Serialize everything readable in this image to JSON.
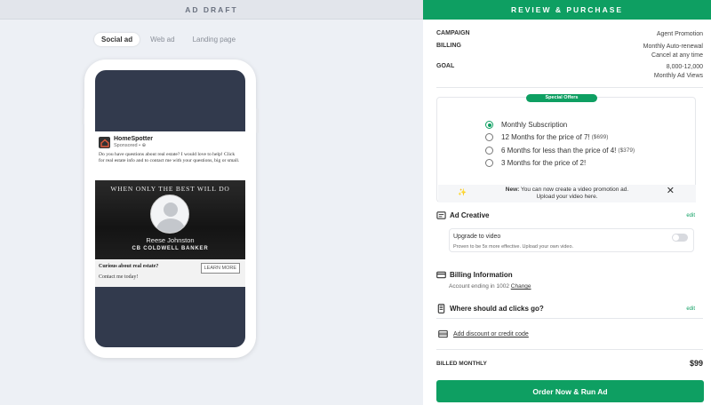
{
  "left": {
    "header": "AD DRAFT",
    "tabs": [
      {
        "label": "Social ad",
        "active": true
      },
      {
        "label": "Web ad",
        "active": false
      },
      {
        "label": "Landing page",
        "active": false
      }
    ],
    "post": {
      "brand_name": "HomeSpotter",
      "sponsored": "Sponsored • ⊕",
      "text": "Do you have questions about real estate? I would love to help! Click for real estate info and to contact me with your questions, big or small.",
      "image_tagline": "WHEN ONLY THE BEST WILL DO",
      "agent_name": "Reese Johnston",
      "brokerage": "CB COLDWELL BANKER",
      "cta_title": "Curious about real estate?",
      "cta_sub": "Contact me today!",
      "cta_button": "LEARN MORE"
    }
  },
  "right": {
    "header": "REVIEW & PURCHASE",
    "campaign_label": "CAMPAIGN",
    "campaign_value": "Agent Promotion",
    "billing_label": "BILLING",
    "billing_value1": "Monthly Auto-renewal",
    "billing_value2": "Cancel at any time",
    "goal_label": "GOAL",
    "goal_value1": "8,000-12,000",
    "goal_value2": "Monthly Ad Views",
    "offers_badge": "Special Offers",
    "offers": [
      {
        "label": "Monthly Subscription",
        "price": "",
        "selected": true
      },
      {
        "label": "12 Months for the price of 7!",
        "price": "($699)",
        "selected": false
      },
      {
        "label": "6 Months for less than the price of 4!",
        "price": "($379)",
        "selected": false
      },
      {
        "label": "3 Months for the price of 2!",
        "price": "",
        "selected": false
      }
    ],
    "notice_bold": "New:",
    "notice_text": "You can now create a video promotion ad.",
    "notice_text2": "Upload your video here.",
    "ad_creative": "Ad Creative",
    "edit": "edit",
    "upgrade_title": "Upgrade to video",
    "upgrade_sub": "Proven to be 5x more effective. Upload your own video.",
    "billing_info": "Billing Information",
    "account_text": "Account ending in 1002",
    "change": "Change",
    "ad_clicks": "Where should ad clicks go?",
    "discount": "Add discount or credit code",
    "billed_label": "BILLED MONTHLY",
    "billed_value": "$99",
    "order_button": "Order Now & Run Ad"
  }
}
